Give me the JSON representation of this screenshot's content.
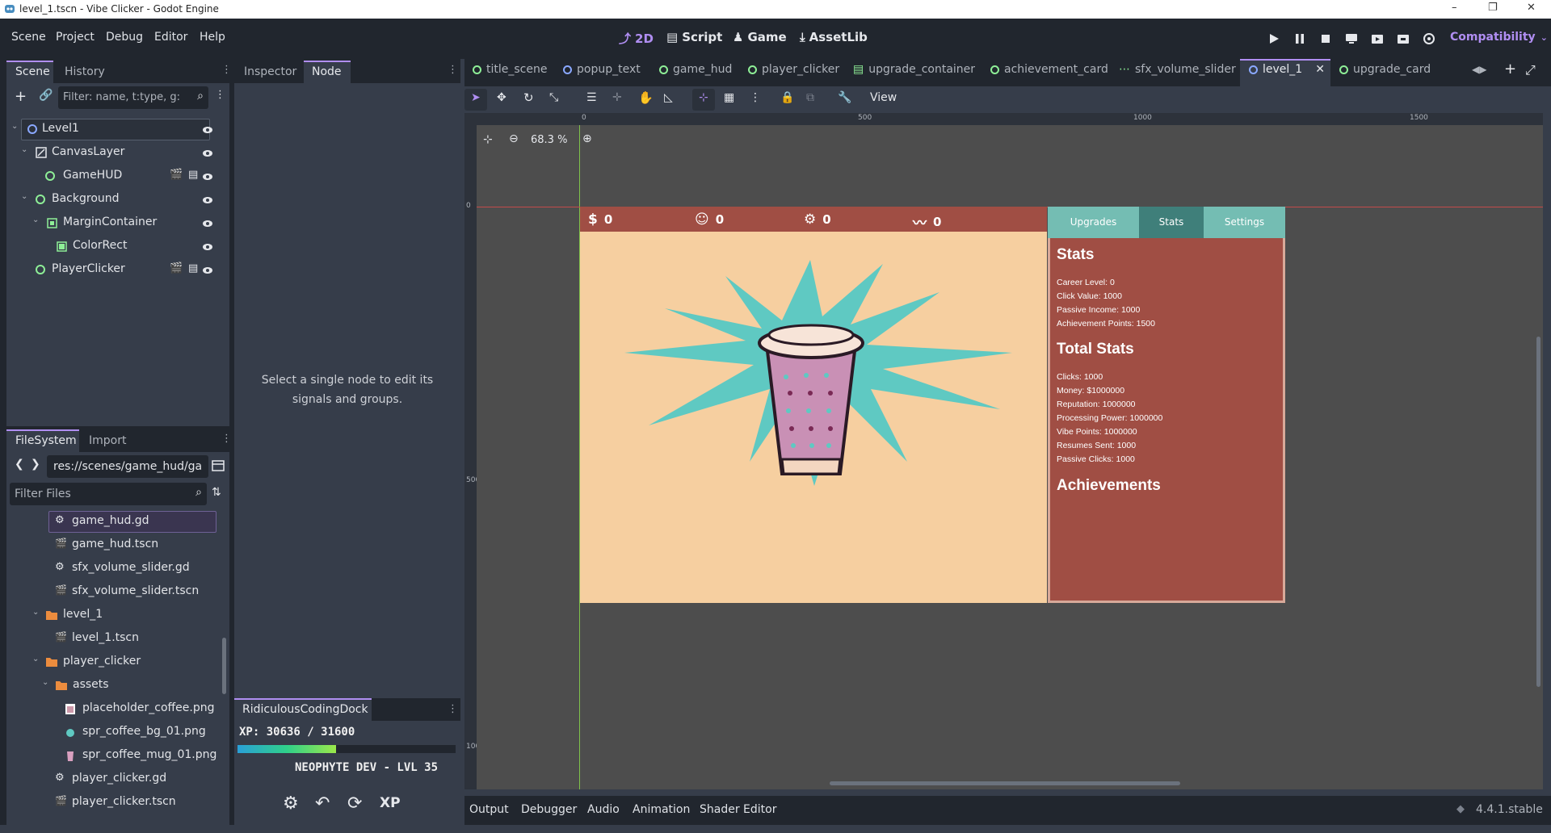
{
  "window": {
    "title": "level_1.tscn - Vibe Clicker - Godot Engine"
  },
  "menu": [
    "Scene",
    "Project",
    "Debug",
    "Editor",
    "Help"
  ],
  "workspaces": [
    {
      "label": "2D",
      "active": true,
      "icon": "2d-icon"
    },
    {
      "label": "Script",
      "active": false,
      "icon": "script-icon"
    },
    {
      "label": "Game",
      "active": false,
      "icon": "game-icon"
    },
    {
      "label": "AssetLib",
      "active": false,
      "icon": "assetlib-icon"
    }
  ],
  "renderer": "Compatibility",
  "scene_dock": {
    "tabs": [
      "Scene",
      "History"
    ],
    "filter_placeholder": "Filter: name, t:type, g:",
    "tree": [
      {
        "label": "Level1",
        "selected": true
      },
      {
        "label": "CanvasLayer"
      },
      {
        "label": "GameHUD"
      },
      {
        "label": "Background"
      },
      {
        "label": "MarginContainer"
      },
      {
        "label": "ColorRect"
      },
      {
        "label": "PlayerClicker"
      }
    ]
  },
  "inspector_dock": {
    "tabs": [
      "Inspector",
      "Node"
    ],
    "message": "Select a single node to edit its signals and groups."
  },
  "filesystem_dock": {
    "tabs": [
      "FileSystem",
      "Import"
    ],
    "path": "res://scenes/game_hud/ga",
    "filter_placeholder": "Filter Files",
    "items": [
      {
        "label": "game_hud.gd",
        "selected": true
      },
      {
        "label": "game_hud.tscn"
      },
      {
        "label": "sfx_volume_slider.gd"
      },
      {
        "label": "sfx_volume_slider.tscn"
      },
      {
        "label": "level_1"
      },
      {
        "label": "level_1.tscn"
      },
      {
        "label": "player_clicker"
      },
      {
        "label": "assets"
      },
      {
        "label": "placeholder_coffee.png"
      },
      {
        "label": "spr_coffee_bg_01.png"
      },
      {
        "label": "spr_coffee_mug_01.png"
      },
      {
        "label": "player_clicker.gd"
      },
      {
        "label": "player_clicker.tscn"
      }
    ]
  },
  "coding_dock": {
    "title": "RidiculousCodingDock",
    "xp": "XP: 30636 / 31600",
    "xp_progress": 0.45,
    "rank": "NEOPHYTE DEV - LVL 35"
  },
  "editor_tabs": [
    {
      "label": "title_scene"
    },
    {
      "label": "popup_text"
    },
    {
      "label": "game_hud"
    },
    {
      "label": "player_clicker"
    },
    {
      "label": "upgrade_container"
    },
    {
      "label": "achievement_card"
    },
    {
      "label": "sfx_volume_slider"
    },
    {
      "label": "level_1",
      "active": true
    },
    {
      "label": "upgrade_card"
    }
  ],
  "toolbar": {
    "view_label": "View",
    "zoom": "68.3 %"
  },
  "rulers": {
    "h_ticks": [
      "0",
      "500",
      "1000",
      "1500"
    ],
    "v_ticks": [
      "0",
      "500",
      "1000"
    ]
  },
  "game": {
    "hud": [
      {
        "icon": "dollar-icon",
        "value": "0"
      },
      {
        "icon": "smiley-icon",
        "value": "0"
      },
      {
        "icon": "chip-icon",
        "value": "0"
      },
      {
        "icon": "pulse-icon",
        "value": "0"
      }
    ],
    "side_tabs": [
      "Upgrades",
      "Stats",
      "Settings"
    ],
    "stats_title": "Stats",
    "stats": [
      "Career Level: 0",
      "Click Value: 1000",
      "Passive Income: 1000",
      "Achievement Points: 1500"
    ],
    "total_title": "Total Stats",
    "totals": [
      "Clicks: 1000",
      "Money: $1000000",
      "Reputation: 1000000",
      "Processing Power: 1000000",
      "Vibe Points: 1000000",
      "Resumes Sent: 1000",
      "Passive Clicks: 1000"
    ],
    "achievements_title": "Achievements"
  },
  "bottom_tabs": [
    "Output",
    "Debugger",
    "Audio",
    "Animation",
    "Shader Editor"
  ],
  "version": "4.4.1.stable",
  "colors": {
    "accent": "#b08ef2",
    "node_green": "#8eef97",
    "hud_red": "#a04e44",
    "canvas_bg": "#f6cfa0",
    "splash": "#5fc9c2",
    "tab_teal": "#74bdb3"
  }
}
